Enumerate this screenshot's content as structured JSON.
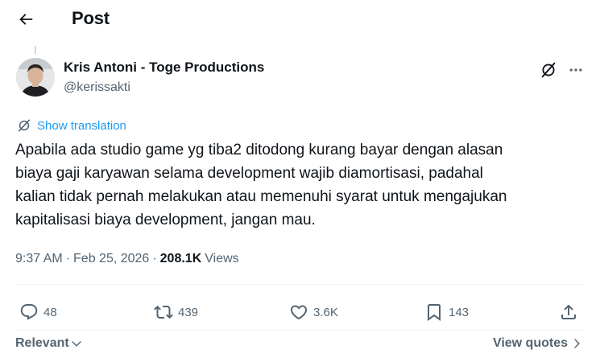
{
  "header": {
    "title": "Post",
    "back_icon": "arrow-left-icon"
  },
  "author": {
    "name": "Kris Antoni - Toge Productions",
    "handle": "@kerissakti",
    "avatar_icon": "avatar-photo"
  },
  "translation": {
    "label": "Show translation",
    "icon": "translate-icon",
    "color": "#1d9bf0"
  },
  "tweet": {
    "text": "Apabila ada studio game yg tiba2 ditodong kurang bayar dengan alasan\nbiaya gaji karyawan selama development wajib diamortisasi, padahal\nkalian tidak pernah melakukan atau memenuhi syarat untuk mengajukan\nkapitalisasi biaya development, jangan mau."
  },
  "meta": {
    "time": "9:37 AM",
    "separator": "·",
    "date": "Feb 25, 2026",
    "views_count": "208.1K",
    "views_label": "Views"
  },
  "actions": {
    "replies": "48",
    "reposts": "439",
    "likes": "3.6K",
    "bookmarks": "143"
  },
  "footer": {
    "sort_label": "Relevant",
    "quotes_label": "View quotes"
  },
  "colors": {
    "text": "#0f1419",
    "secondary": "#536471",
    "accent": "#1d9bf0",
    "divider": "#eff3f4"
  }
}
